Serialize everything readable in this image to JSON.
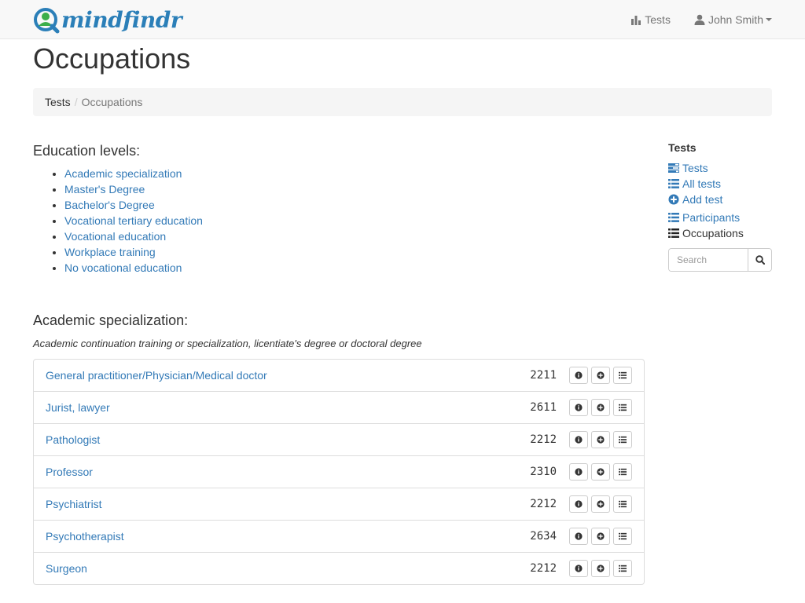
{
  "brand": {
    "name": "mindfindr"
  },
  "nav": {
    "tests_label": "Tests",
    "user_label": "John Smith"
  },
  "page": {
    "title": "Occupations"
  },
  "breadcrumb": {
    "items": [
      "Tests",
      "Occupations"
    ]
  },
  "education": {
    "heading": "Education levels:",
    "levels": [
      "Academic specialization",
      "Master's Degree",
      "Bachelor's Degree",
      "Vocational tertiary education",
      "Vocational education",
      "Workplace training",
      "No vocational education"
    ]
  },
  "specialization": {
    "heading": "Academic specialization:",
    "description": "Academic continuation training or specialization, licentiate's degree or doctoral degree",
    "occupations": [
      {
        "name": "General practitioner/Physician/Medical doctor",
        "code": "2211"
      },
      {
        "name": "Jurist, lawyer",
        "code": "2611"
      },
      {
        "name": "Pathologist",
        "code": "2212"
      },
      {
        "name": "Professor",
        "code": "2310"
      },
      {
        "name": "Psychiatrist",
        "code": "2212"
      },
      {
        "name": "Psychotherapist",
        "code": "2634"
      },
      {
        "name": "Surgeon",
        "code": "2212"
      }
    ]
  },
  "sidebar": {
    "heading": "Tests",
    "items": [
      {
        "label": "Tests",
        "icon": "tasks-icon"
      },
      {
        "label": "All tests",
        "icon": "list-icon"
      },
      {
        "label": "Add test",
        "icon": "plus-circle-icon"
      },
      {
        "label": "Participants",
        "icon": "list-icon"
      },
      {
        "label": "Occupations",
        "icon": "list-icon"
      }
    ],
    "search_placeholder": "Search"
  },
  "colors": {
    "link": "#337ab7",
    "brand": "#2b7fb8",
    "navbar_bg": "#f8f8f8"
  }
}
